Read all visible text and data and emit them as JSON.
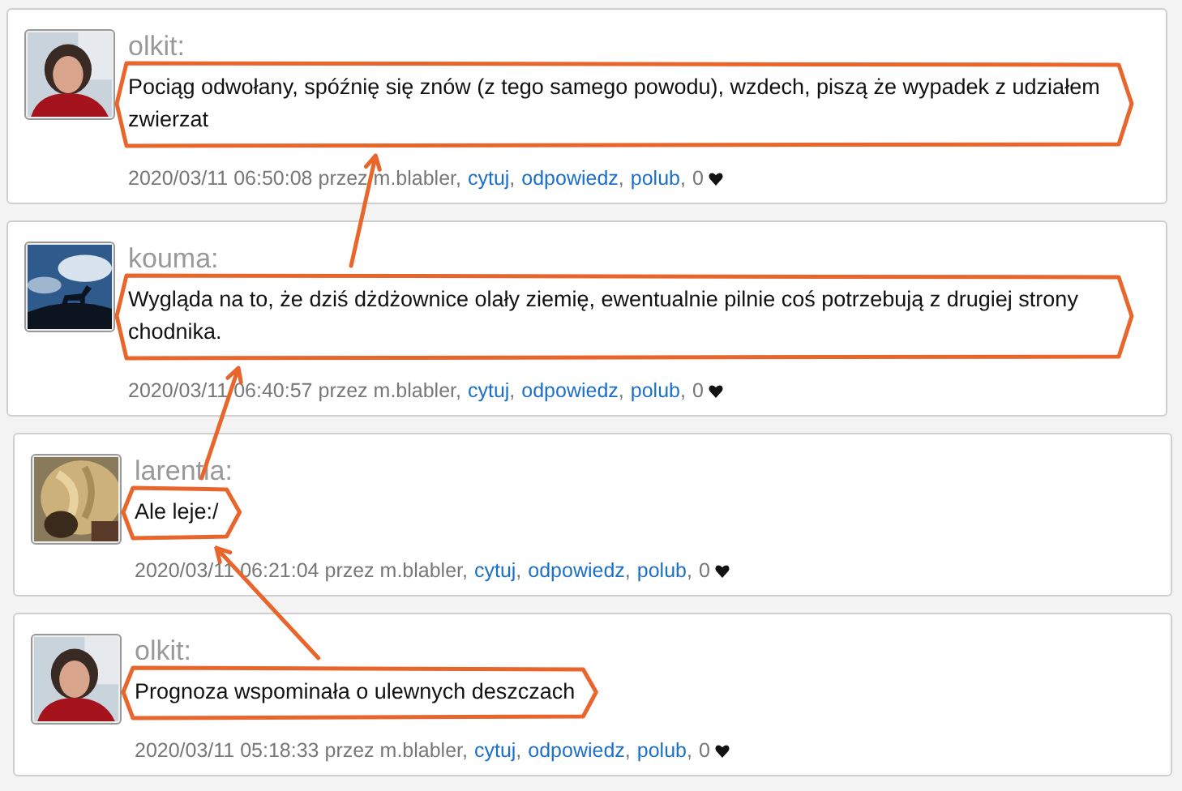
{
  "comments": [
    {
      "avatar": {
        "kind": "picture"
      },
      "author": "olkit:",
      "message": " Pociąg odwołany, spóźnię się znów (z tego samego powodu), wzdech, piszą że wypadek z udziałem zwierzat",
      "highlighted": true,
      "arrow_to_previous": false,
      "timestamp": "2020/03/11 06:50:08 przez m.blabler,",
      "links": [
        {
          "label": "cytuj",
          "after": ","
        },
        {
          "label": "odpowiedz",
          "after": ","
        },
        {
          "label": "polub",
          "after": ","
        }
      ],
      "likes": "0"
    },
    {
      "avatar": {
        "kind": "picture"
      },
      "author": "kouma:",
      "message": " Wygląda na to, że dziś dżdżownice olały ziemię, ewentualnie pilnie coś potrzebują z drugiej strony chodnika.",
      "highlighted": true,
      "arrow_to_previous": true,
      "timestamp": "2020/03/11 06:40:57 przez m.blabler,",
      "links": [
        {
          "label": "cytuj",
          "after": ","
        },
        {
          "label": "odpowiedz",
          "after": ","
        },
        {
          "label": "polub",
          "after": ","
        }
      ],
      "likes": "0"
    },
    {
      "avatar": {
        "kind": "picture"
      },
      "author": "larentia:",
      "message": "Ale leje:/",
      "highlighted": true,
      "arrow_to_previous": true,
      "timestamp": "2020/03/11 06:21:04 przez m.blabler,",
      "links": [
        {
          "label": "cytuj",
          "after": ","
        },
        {
          "label": "odpowiedz",
          "after": ","
        },
        {
          "label": "polub",
          "after": ","
        }
      ],
      "likes": "0"
    },
    {
      "avatar": {
        "kind": "picture"
      },
      "author": "olkit:",
      "message": "Prognoza wspominała o ulewnych deszczach",
      "highlighted": true,
      "arrow_to_previous": true,
      "timestamp": "2020/03/11 05:18:33 przez m.blabler,",
      "links": [
        {
          "label": "cytuj",
          "after": ","
        },
        {
          "label": "odpowiedz",
          "after": ","
        },
        {
          "label": "polub",
          "after": ","
        }
      ],
      "likes": "0"
    }
  ]
}
